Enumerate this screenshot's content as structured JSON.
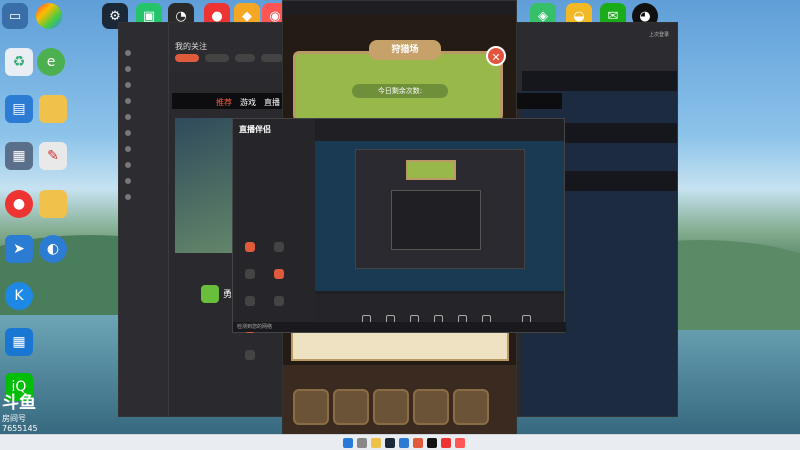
{
  "left_window": {
    "section_title": "我的关注",
    "tabs": [
      "推荐",
      "游戏",
      "直播"
    ],
    "streamer_name": "勇",
    "status": "上次登录"
  },
  "game_popup": {
    "title": "狩猎场",
    "count_text": "今日剩余次数:",
    "close_icon": "close-icon"
  },
  "overlay_window": {
    "brand": "直播伴侣",
    "footer_text": "检测到您的网络"
  },
  "douyu": {
    "room_label": "房间号",
    "room_number": "7655145"
  },
  "colors": {
    "accent": "#e05b3c",
    "game_green": "#98b94a",
    "game_gold": "#c7a16a"
  }
}
